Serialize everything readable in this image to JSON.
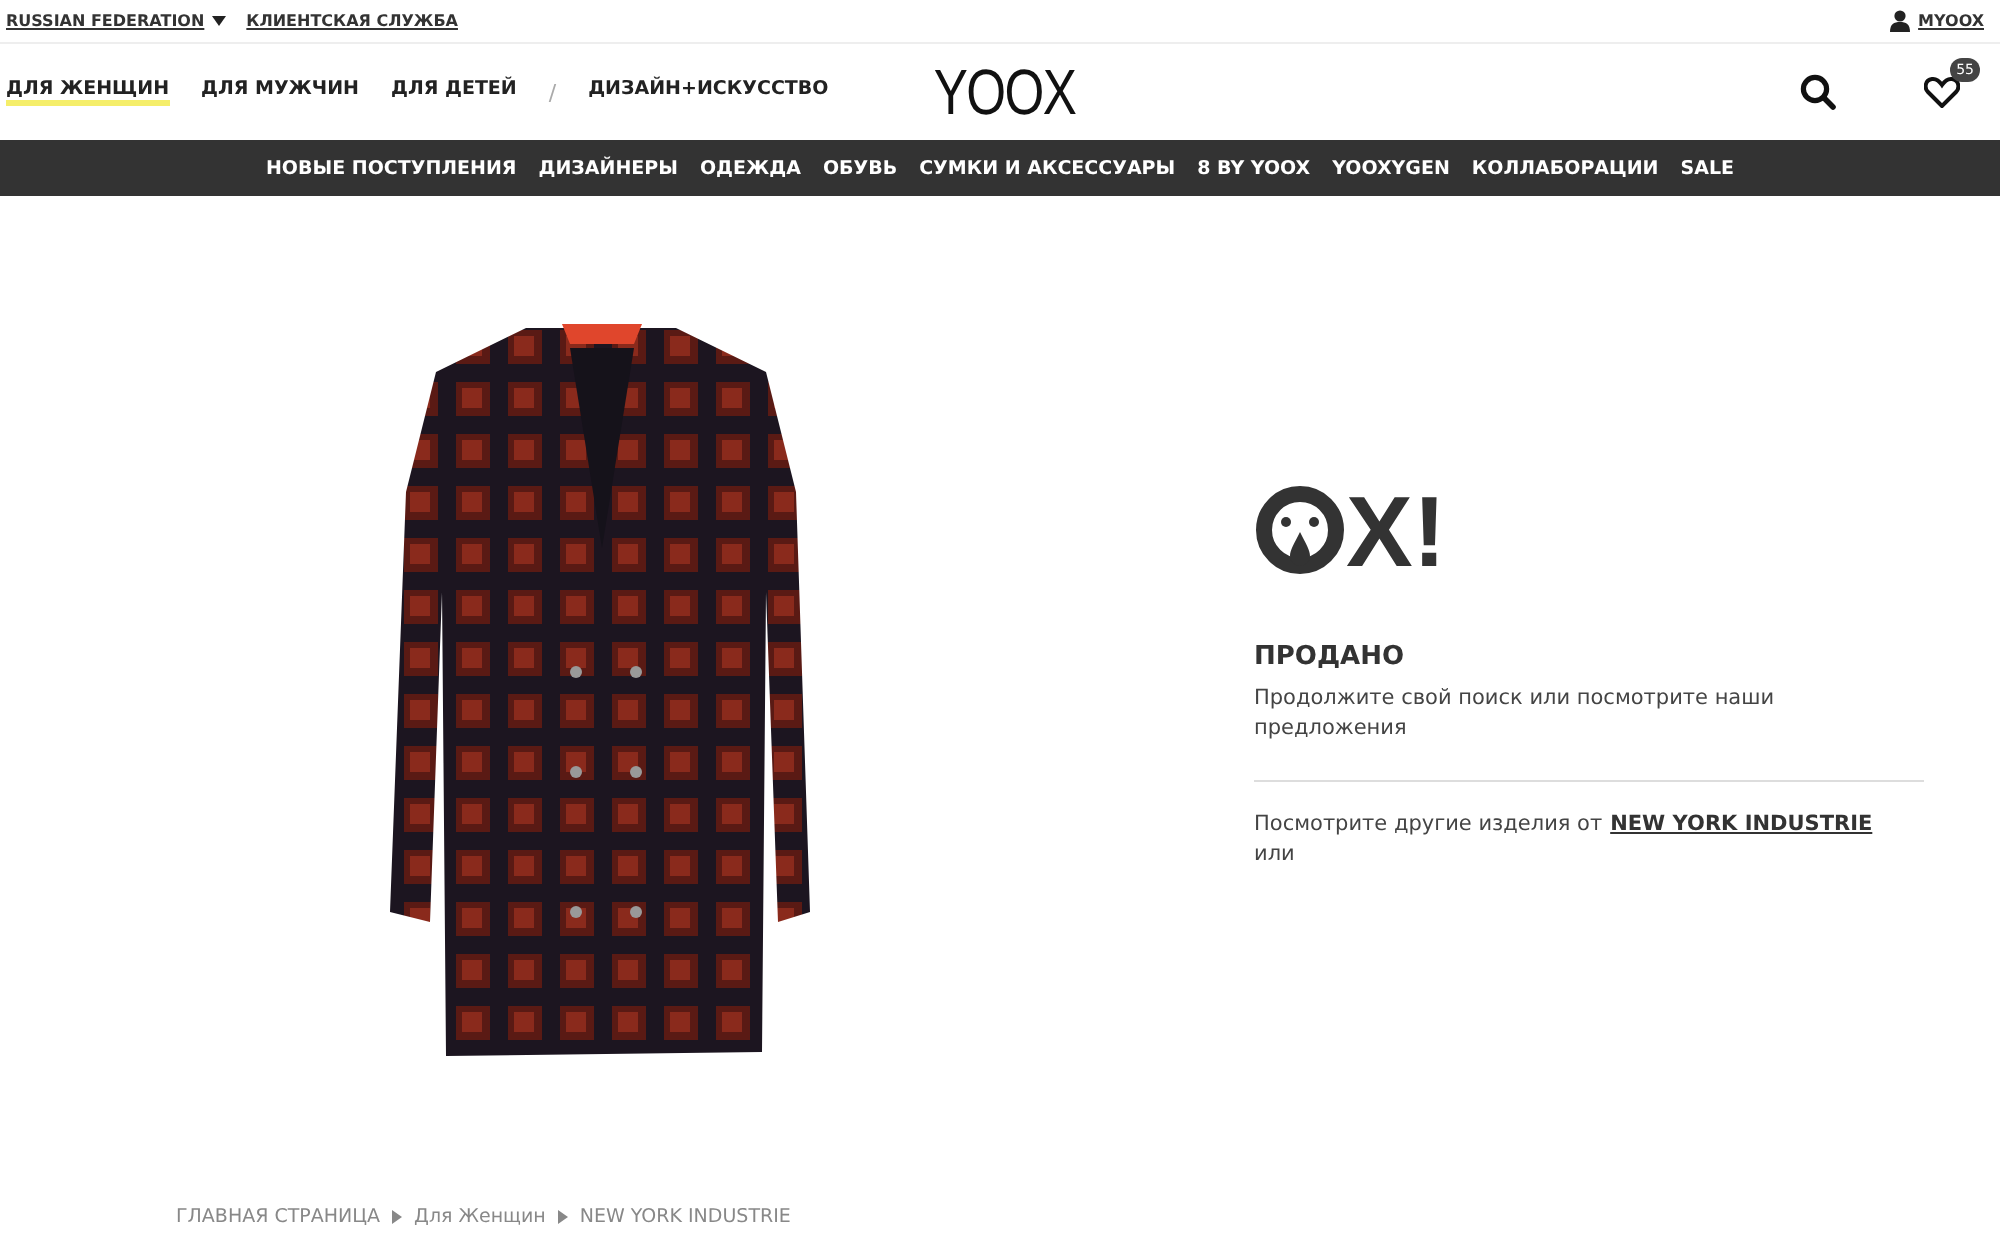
{
  "top_bar": {
    "country": "RUSSIAN FEDERATION",
    "service": "КЛИЕНТСКАЯ СЛУЖБА",
    "account": "MYOOX"
  },
  "header": {
    "sections": [
      {
        "kind": "link",
        "label": "ДЛЯ ЖЕНЩИН",
        "selected": true
      },
      {
        "kind": "link",
        "label": "ДЛЯ МУЖЧИН",
        "selected": false
      },
      {
        "kind": "link",
        "label": "ДЛЯ ДЕТЕЙ",
        "selected": false
      },
      {
        "kind": "separator",
        "label": "/",
        "selected": false
      },
      {
        "kind": "link",
        "label": "ДИЗАЙН+ИСКУССТВО",
        "selected": false
      }
    ],
    "logo": "YOOX",
    "wishlist_count": "55"
  },
  "menu": [
    "НОВЫЕ ПОСТУПЛЕНИЯ",
    "ДИЗАЙНЕРЫ",
    "ОДЕЖДА",
    "ОБУВЬ",
    "СУМКИ И АКСЕССУАРЫ",
    "8 BY YOOX",
    "YOOXYGEN",
    "КОЛЛАБОРАЦИИ",
    "SALE"
  ],
  "sold_out": {
    "exclamation": "X!",
    "title": "ПРОДАНО",
    "message": "Продолжите свой поиск или посмотрите наши предложения",
    "more_text": "Посмотрите другие изделия от",
    "brand_link": "NEW YORK INDUSTRIE",
    "more_tail": "или"
  },
  "breadcrumb": [
    "ГЛАВНАЯ СТРАНИЦА",
    "Для Женщин",
    "NEW YORK INDUSTRIE"
  ]
}
